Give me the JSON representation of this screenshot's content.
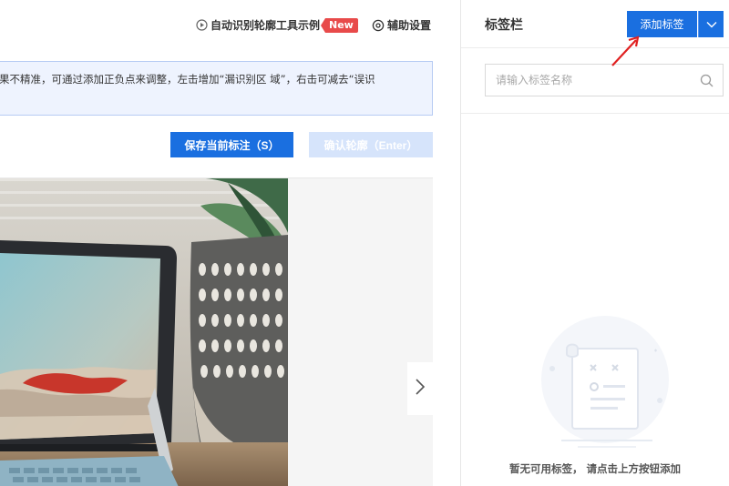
{
  "topbar": {
    "example_label": "自动识别轮廓工具示例",
    "new_badge": "New",
    "settings_label": "辅助设置"
  },
  "notice": {
    "text": "果不精准，可通过添加正负点来调整，左击增加“漏识别区 域”，右击可减去“误识"
  },
  "actions": {
    "save_label": "保存当前标注（S）",
    "confirm_label": "确认轮廓（Enter）"
  },
  "panel": {
    "title": "标签栏",
    "add_label": "添加标签",
    "search_placeholder": "请输入标签名称",
    "empty_text": "暂无可用标签， 请点击上方按钮添加"
  },
  "colors": {
    "primary": "#1a6fe0",
    "primary_disabled": "#d6e4fb",
    "badge": "#e84a4a",
    "notice_bg": "#eef3fe",
    "annotation_arrow": "#e02020"
  },
  "icons": {
    "example": "play-circle-icon",
    "settings": "gear-icon",
    "search": "search-icon",
    "dropdown": "chevron-down-icon",
    "next": "chevron-right-icon"
  }
}
